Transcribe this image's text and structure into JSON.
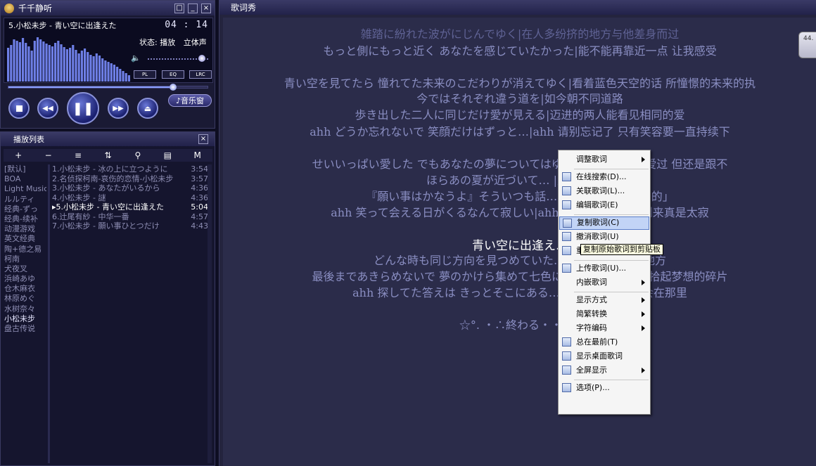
{
  "player": {
    "title": "千千静听",
    "song": "5.小松未步 - 青い空に出逢えた",
    "time": "04 : 14",
    "state": "状态: 播放",
    "channel": "立体声",
    "btn_pl": "PL",
    "btn_eq": "EQ",
    "btn_lrc": "LRC",
    "music_window": "♪音乐窗",
    "progress": 0.81,
    "volume": 0.85,
    "spectrum": [
      48,
      52,
      60,
      58,
      56,
      62,
      55,
      50,
      44,
      58,
      63,
      60,
      57,
      54,
      52,
      50,
      55,
      58,
      53,
      49,
      46,
      48,
      52,
      45,
      40,
      44,
      47,
      42,
      38,
      36,
      40,
      37,
      33,
      30,
      28,
      26,
      24,
      21,
      18,
      15,
      12,
      9
    ]
  },
  "playlist": {
    "title": "播放列表",
    "groups": [
      "[默认]",
      "BOA",
      "Light Music",
      "ルルティ",
      "经典-ずっ",
      "经典-续补",
      "动漫游戏",
      "英文经典",
      "陶+德之易",
      "柯南",
      "犬夜叉",
      "浜崎あゆ",
      "仓木麻衣",
      "林原めぐ",
      "水树奈々",
      "小松未步",
      "盘古传说"
    ],
    "selected_group": 15,
    "tracks": [
      {
        "name": "1.小松未步 - 冰の上に立つように",
        "dur": "3:54"
      },
      {
        "name": "2.名侦探柯南-哀伤的恋情-小松未步",
        "dur": "3:57"
      },
      {
        "name": "3.小松未步 - あなたがいるから",
        "dur": "4:36"
      },
      {
        "name": "4.小松未步 - 謎",
        "dur": "4:36"
      },
      {
        "name": "▸5.小松未步 - 青い空に出逢えた",
        "dur": "5:04"
      },
      {
        "name": "6.辻尾有紗 - 中华一番",
        "dur": "4:57"
      },
      {
        "name": "7.小松未步 - 願い事ひとつだけ",
        "dur": "4:43"
      }
    ],
    "active_track": 4
  },
  "lyric": {
    "title": "歌词秀",
    "badge": "44.",
    "lines": [
      {
        "text": "雑踏に紛れた波がにじんでゆく|在人多纷挤的地方与他差身而过",
        "faint": true
      },
      {
        "text": "もっと側にもっと近く あなたを感じていたかった|能不能再靠近一点 让我感受",
        "faint": false
      },
      {
        "text": "",
        "faint": false
      },
      {
        "text": "青い空を見てたら 憧れてた未来のこだわりが消えてゆく|看着蓝色天空的话 所憧憬的未来的执",
        "faint": false
      },
      {
        "text": "今ではそれぞれ違う道を|如今朝不同道路",
        "faint": false
      },
      {
        "text": "歩き出した二人に同じだけ愛が見える|迈进的两人能看见相同的爱",
        "faint": false
      },
      {
        "text": "ahh どうか忘れないで 笑顔だけはずっと…|ahh 请别忘记了 只有笑容要一直持续下",
        "faint": false
      },
      {
        "text": "",
        "faint": false
      },
      {
        "text": "せいいっぱい愛した でもあなたの夢についてはゆけな…|尽全力去爱过 但还是跟不",
        "faint": false
      },
      {
        "text": "ほらあの夏が近づいて… |夏天接近了",
        "faint": false
      },
      {
        "text": "『願い事はかなうよ』そういつも話…|说着「愿望会实现的」",
        "faint": false
      },
      {
        "text": "ahh 笑って会える日がくるなんて寂しい|ahh …相逢的日子会到来真是太寂",
        "faint": false
      },
      {
        "text": "",
        "faint": false
      },
      {
        "text": "青い空に出逢え…",
        "faint": false,
        "current": true
      },
      {
        "text": "どんな時も同じ方向を見つめていた…想注视着同一个地方",
        "faint": false
      },
      {
        "text": "最後まであきらめないで 夢のかけら集めて七色に輝か…|请别放弃 拾起梦想的碎片",
        "faint": false
      },
      {
        "text": "ahh 探してた答えは きっとそこにある…寻找的答案 一定会在那里",
        "faint": false
      },
      {
        "text": "",
        "faint": false
      },
      {
        "text": "☆°. ・∴終わる・・ .・",
        "faint": false
      }
    ]
  },
  "context_menu": {
    "items": [
      {
        "label": "调整歌词",
        "submenu": true,
        "icon": false
      },
      {
        "divider": true
      },
      {
        "label": "在线搜索(D)...",
        "icon": "search-lyric-icon"
      },
      {
        "label": "关联歌词(L)...",
        "icon": "link-lyric-icon"
      },
      {
        "label": "编辑歌词(E)",
        "icon": "edit-lyric-icon"
      },
      {
        "divider": true
      },
      {
        "label": "复制歌词(C)",
        "icon": "copy-icon",
        "hover": true
      },
      {
        "label": "撤消歌词(U)",
        "icon": "undo-icon"
      },
      {
        "label": "重新载入(R)",
        "icon": "reload-icon"
      },
      {
        "divider": true
      },
      {
        "label": "上传歌词(U)...",
        "icon": "upload-icon"
      },
      {
        "label": "内嵌歌词",
        "submenu": true
      },
      {
        "divider": true
      },
      {
        "label": "显示方式",
        "submenu": true
      },
      {
        "label": "简繁转换",
        "submenu": true
      },
      {
        "label": "字符编码",
        "submenu": true
      },
      {
        "label": "总在最前(T)",
        "icon": "pin-icon"
      },
      {
        "label": "显示桌面歌词",
        "icon": "desktop-lyric-icon"
      },
      {
        "label": "全屏显示",
        "submenu": true,
        "icon": "fullscreen-icon"
      },
      {
        "divider": true
      },
      {
        "label": "选项(P)...",
        "icon": "options-icon"
      }
    ],
    "tooltip": "复制原始歌词到剪贴板"
  },
  "colors": {
    "accent": "#8aa0ff",
    "lyric_text": "#8a8ec2",
    "current_line": "#ffffff"
  }
}
